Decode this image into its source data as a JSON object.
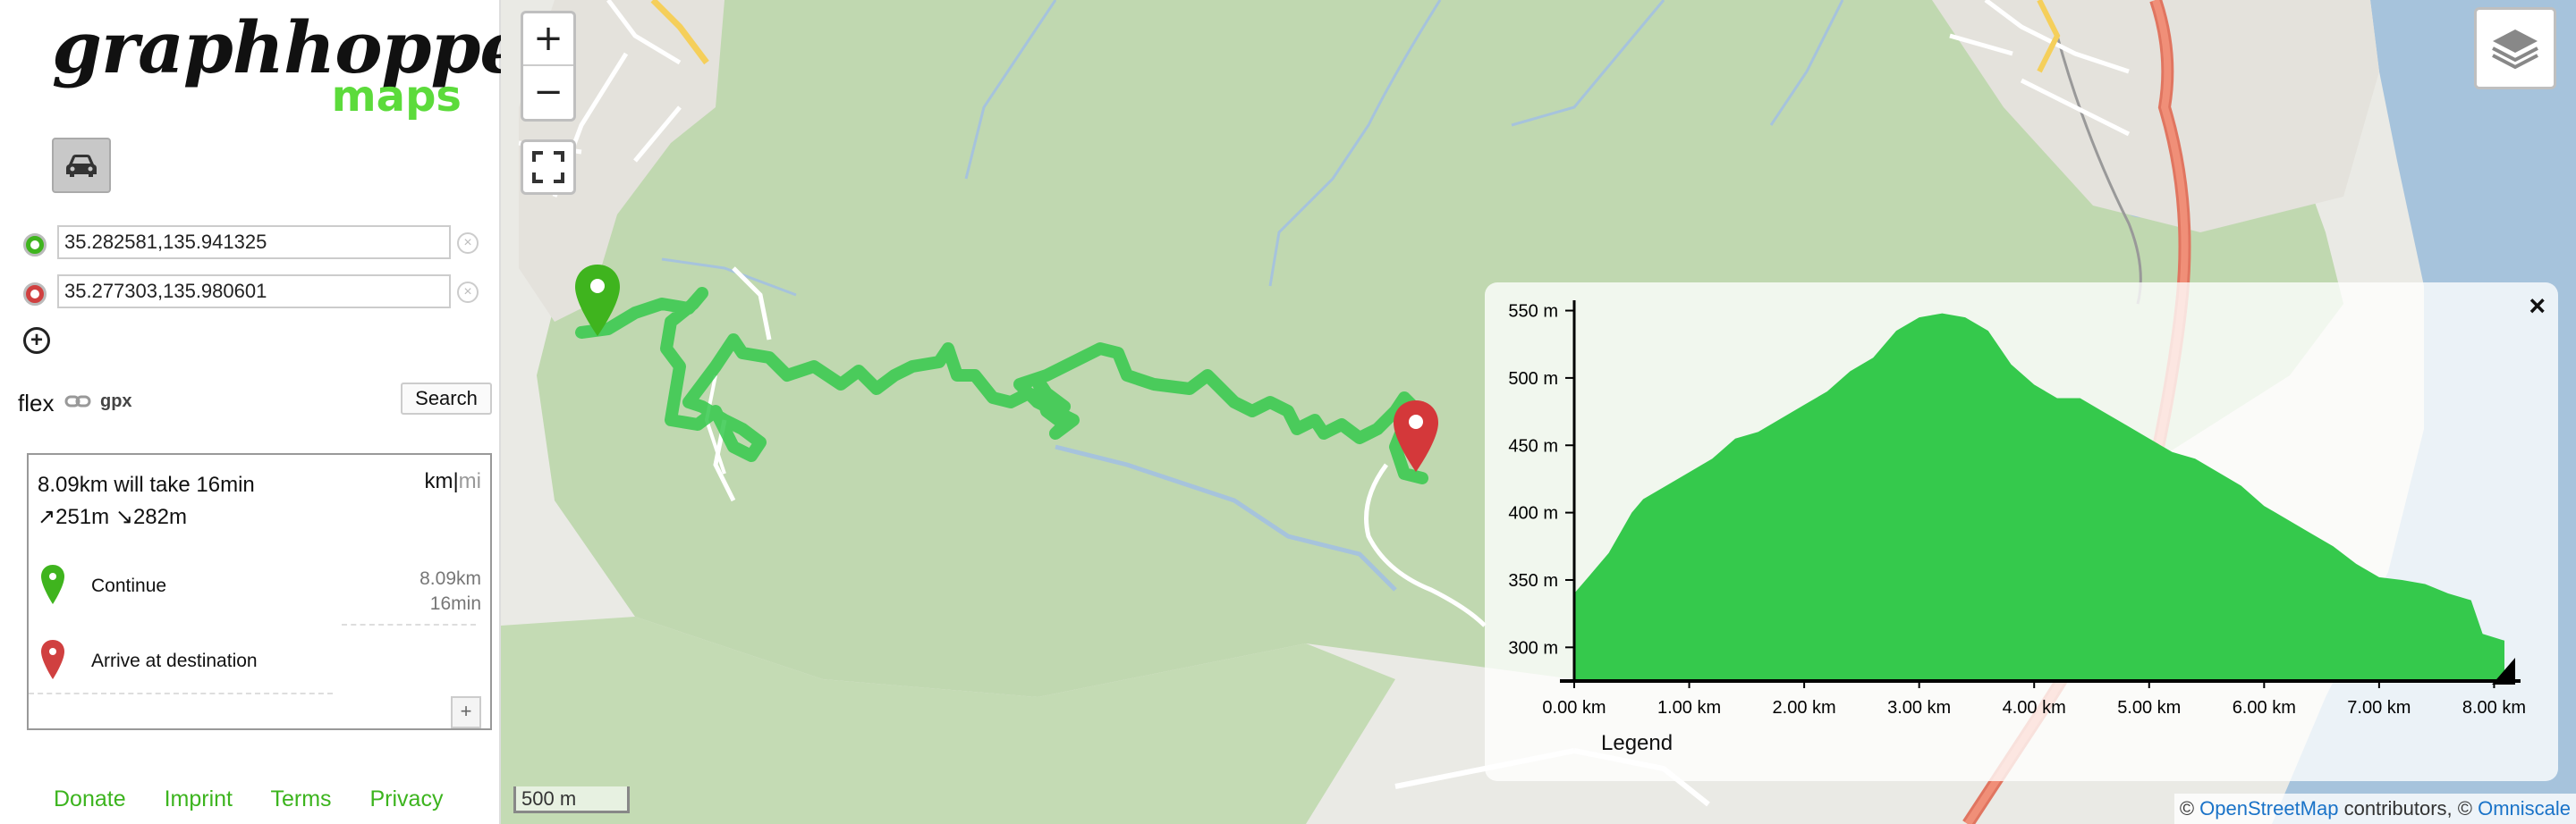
{
  "logo": {
    "brand": "graphhopper",
    "sub": "maps"
  },
  "vehicle": {
    "icon": "car-icon",
    "active": true
  },
  "points": [
    {
      "value": "35.282581,135.941325",
      "color": "#3fb41e",
      "role": "start"
    },
    {
      "value": "35.277303,135.980601",
      "color": "#d04040",
      "role": "end"
    }
  ],
  "options": {
    "profile": "flex",
    "gpx_label": "gpx",
    "search_label": "Search"
  },
  "route": {
    "summary_line1": "8.09km will take 16min",
    "ascend": "↗251m",
    "descend": "↘282m",
    "unit_km": "km",
    "unit_sep": "|",
    "unit_mi": "mi",
    "instructions": [
      {
        "text": "Continue",
        "distance": "8.09km",
        "time": "16min",
        "pin": "green-pin-icon"
      },
      {
        "text": "Arrive at destination",
        "distance": "",
        "time": "",
        "pin": "red-pin-icon"
      }
    ],
    "expand_label": "+"
  },
  "footer": {
    "links": [
      "Donate",
      "Imprint",
      "Terms",
      "Privacy"
    ]
  },
  "map": {
    "zoom_in": "+",
    "zoom_out": "−",
    "scale": "500 m",
    "attribution": {
      "prefix": "© ",
      "osm": "OpenStreetMap",
      "middle": " contributors, © ",
      "omni": "Omniscale"
    },
    "colors": {
      "route": "#35c94c",
      "forest": "#c0d8b0",
      "water": "#a6c3dc"
    }
  },
  "elevation": {
    "close_label": "×",
    "legend": "Legend",
    "chart_data": {
      "type": "area",
      "x": [
        0.0,
        0.1,
        0.3,
        0.5,
        0.6,
        0.8,
        1.0,
        1.2,
        1.4,
        1.6,
        1.8,
        2.0,
        2.2,
        2.4,
        2.6,
        2.8,
        3.0,
        3.2,
        3.4,
        3.6,
        3.8,
        4.0,
        4.2,
        4.4,
        4.6,
        4.8,
        5.0,
        5.2,
        5.4,
        5.6,
        5.8,
        6.0,
        6.2,
        6.4,
        6.6,
        6.8,
        7.0,
        7.2,
        7.4,
        7.6,
        7.8,
        7.9,
        8.09
      ],
      "values": [
        340,
        350,
        370,
        400,
        410,
        420,
        430,
        440,
        455,
        460,
        470,
        480,
        490,
        505,
        515,
        535,
        545,
        548,
        545,
        535,
        510,
        495,
        485,
        485,
        475,
        465,
        455,
        445,
        440,
        430,
        420,
        405,
        395,
        385,
        375,
        362,
        352,
        350,
        347,
        340,
        335,
        310,
        305
      ],
      "xlabel": "",
      "ylabel": "",
      "x_ticks": [
        "0.00 km",
        "1.00 km",
        "2.00 km",
        "3.00 km",
        "4.00 km",
        "5.00 km",
        "6.00 km",
        "7.00 km",
        "8.00 km"
      ],
      "y_ticks": [
        "550 m",
        "500 m",
        "450 m",
        "400 m",
        "350 m",
        "300 m"
      ],
      "xlim": [
        0,
        8.09
      ],
      "ylim": [
        275,
        555
      ],
      "color": "#35c94c"
    }
  }
}
